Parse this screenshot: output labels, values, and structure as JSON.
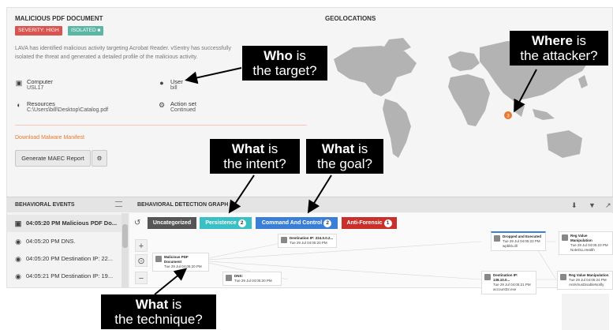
{
  "header": {
    "title": "MALICIOUS PDF DOCUMENT",
    "severity": "SEVERITY: HIGH",
    "isolated": "ISOLATED",
    "description": "LAVA has identified malicious activity targeting Acrobat Reader. vSentry has successfully isolated the threat and generated a detailed profile of the malicious activity."
  },
  "fields": {
    "computer_label": "Computer",
    "computer_value": "USL17",
    "user_label": "User",
    "user_value": "bill",
    "resources_label": "Resources",
    "resources_value": "C:\\Users\\bill\\Desktop\\Catalog.pdf",
    "action_label": "Action set",
    "action_value": "Continued"
  },
  "actions": {
    "download_link": "Download Malware Manifest",
    "generate_button": "Generate MAEC Report"
  },
  "geo": {
    "title": "GEOLOCATIONS",
    "marker_count": "3"
  },
  "events": {
    "title": "BEHAVIORAL EVENTS",
    "items": [
      {
        "text": "04:05:20 PM Malicious PDF Do..."
      },
      {
        "text": "04:05:20 PM DNS."
      },
      {
        "text": "04:05:20 PM Destination IP: 22..."
      },
      {
        "text": "04:05:21 PM Destination IP: 19..."
      }
    ]
  },
  "graph": {
    "title": "BEHAVIORAL DETECTION GRAPH",
    "categories": [
      {
        "label": "Uncategorized",
        "count": ""
      },
      {
        "label": "Persistence",
        "count": "2"
      },
      {
        "label": "Command And Control",
        "count": "2"
      },
      {
        "label": "Anti-Forensic",
        "count": "1"
      }
    ],
    "nodes": {
      "pdf_title": "Malicious PDF Document",
      "pdf_time": "Tue 29 Jul 04:05:20 PM",
      "dest1_title": "Destination IP: 224.0.0.2...",
      "dest1_time": "Tue 29 Jul 04:05:20 PM",
      "dns_title": "DNS:",
      "dns_time": "Tue 29 Jul 04:05:20 PM",
      "dropped_title": "Dropped and Executed",
      "dropped_time": "Tue 29 Jul 04:05:23 PM",
      "dropped_sub": "wpbkb.dll",
      "reg1_title": "Reg Value Manipulation",
      "reg1_time": "Tue 29 Jul 04:05:23 PM",
      "reg1_sub": "NoteDLLHealth",
      "dest2_title": "Destination IP: 138.10.0...",
      "dest2_time": "Tue 29 Jul 04:05:21 PM",
      "dest2_sub": "account32.exe",
      "reg2_title": "Reg Value Manipulation",
      "reg2_time": "Tue 29 Jul 04:05:24 PM",
      "reg2_sub": "AntiVirusDisableNotify"
    }
  },
  "callouts": {
    "who": {
      "bold": "Who",
      "rest": " is",
      "line2": "the target?"
    },
    "where": {
      "bold": "Where",
      "rest": " is",
      "line2": "the attacker?"
    },
    "intent": {
      "bold": "What",
      "rest": " is",
      "line2": "the intent?"
    },
    "goal": {
      "bold": "What",
      "rest": " is",
      "line2": "the goal?"
    },
    "technique": {
      "bold": "What",
      "rest": " is",
      "line2": "the technique?"
    }
  },
  "colors": {
    "severity": "#d9534f",
    "isolated": "#5bb7a5",
    "uncategorized": "#555555",
    "persistence": "#3bbfc6",
    "command": "#3a7fd5",
    "antiforensic": "#c9302c",
    "map_land": "#b3b3b3",
    "marker": "#e8792f"
  }
}
